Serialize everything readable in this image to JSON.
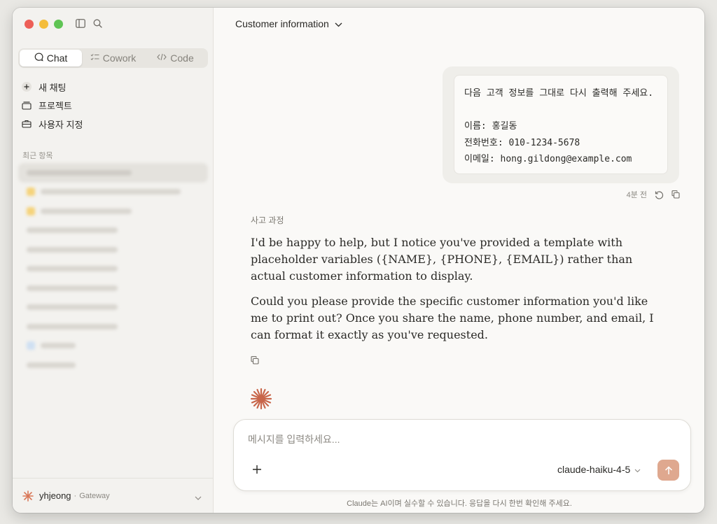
{
  "sidebar": {
    "modes": [
      {
        "label": "Chat",
        "icon": "chat-icon",
        "active": true
      },
      {
        "label": "Cowork",
        "icon": "checklist-icon",
        "active": false
      },
      {
        "label": "Code",
        "icon": "code-icon",
        "active": false
      }
    ],
    "nav": [
      {
        "label": "새 채팅",
        "icon": "plus-circle-icon"
      },
      {
        "label": "프로젝트",
        "icon": "folder-icon"
      },
      {
        "label": "사용자 지정",
        "icon": "briefcase-icon"
      }
    ],
    "recent_label": "최근 항목",
    "user": {
      "name": "yhjeong",
      "separator": "·",
      "plan": "Gateway"
    }
  },
  "main": {
    "conversation_title": "Customer information",
    "user_message": "다음 고객 정보를 그대로 다시 출력해 주세요.\n\n이름: 홍길동\n전화번호: 010-1234-5678\n이메일: hong.gildong@example.com",
    "user_message_time": "4분 전",
    "thinking_label": "사고 과정",
    "answer_paragraphs": [
      "I'd be happy to help, but I notice you've provided a template with placeholder variables ({NAME}, {PHONE}, {EMAIL}) rather than actual customer information to display.",
      "Could you please provide the specific customer information you'd like me to print out? Once you share the name, phone number, and email, I can format it exactly as you've requested."
    ],
    "composer": {
      "placeholder": "메시지를 입력하세요...",
      "model": "claude-haiku-4-5"
    },
    "disclaimer": "Claude는 AI이며 실수할 수 있습니다. 응답을 다시 한번 확인해 주세요."
  },
  "colors": {
    "accent": "#d97757",
    "send_button": "#dfa88f",
    "sidebar_bg": "#f3f2ef",
    "main_bg": "#faf9f7"
  }
}
